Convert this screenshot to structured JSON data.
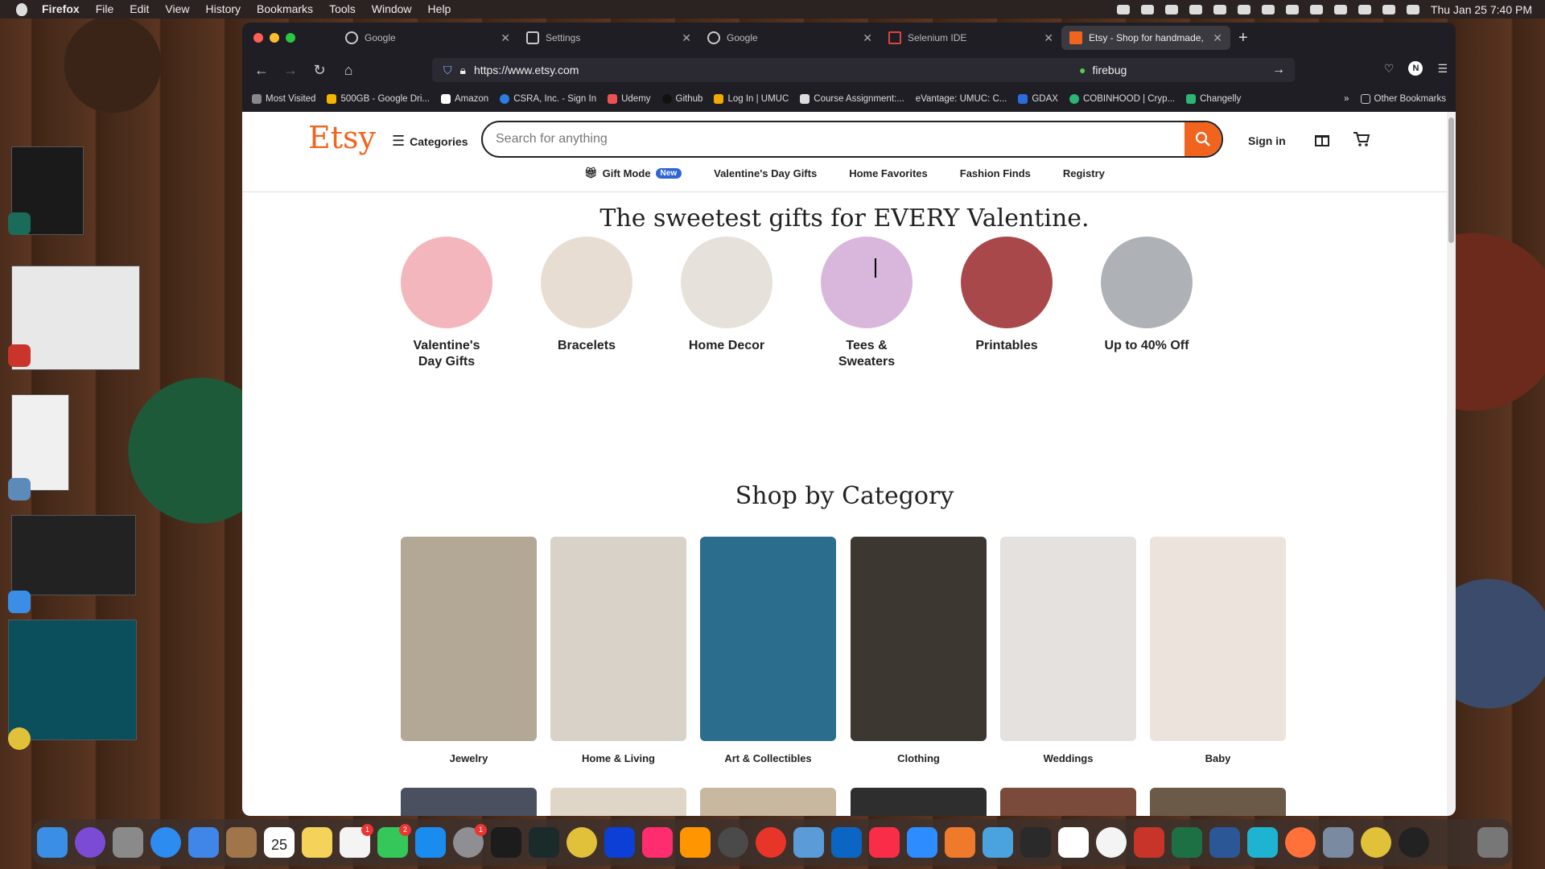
{
  "menubar": {
    "app": "Firefox",
    "items": [
      "File",
      "Edit",
      "View",
      "History",
      "Bookmarks",
      "Tools",
      "Window",
      "Help"
    ],
    "clock": "Thu Jan 25  7:40 PM",
    "recording": "Recording"
  },
  "browser": {
    "tabs": [
      {
        "title": "Google"
      },
      {
        "title": "Settings"
      },
      {
        "title": "Google"
      },
      {
        "title": "Selenium IDE"
      },
      {
        "title": "Etsy - Shop for handmade, vinta"
      }
    ],
    "url": "https://www.etsy.com",
    "search_text": "firebug",
    "bookmarks": [
      "Most Visited",
      "500GB - Google Dri...",
      "Amazon",
      "CSRA, Inc. - Sign In",
      "Udemy",
      "Github",
      "Log In | UMUC",
      "Course Assignment:...",
      "eVantage: UMUC: C...",
      "GDAX",
      "COBINHOOD | Cryp...",
      "Changelly"
    ],
    "other_bookmarks": "Other Bookmarks",
    "profile_initial": "N"
  },
  "etsy": {
    "logo": "Etsy",
    "categories_label": "Categories",
    "search_placeholder": "Search for anything",
    "sign_in": "Sign in",
    "subnav": [
      {
        "label": "Gift Mode",
        "badge": "New"
      },
      {
        "label": "Valentine's Day Gifts"
      },
      {
        "label": "Home Favorites"
      },
      {
        "label": "Fashion Finds"
      },
      {
        "label": "Registry"
      }
    ],
    "hero": "The sweetest gifts for EVERY Valentine.",
    "circles": [
      {
        "line1": "Valentine's",
        "line2": "Day Gifts",
        "color": "#f3b6bd"
      },
      {
        "line1": "Bracelets",
        "line2": "",
        "color": "#e8ddd2"
      },
      {
        "line1": "Home Decor",
        "line2": "",
        "color": "#e6e1da"
      },
      {
        "line1": "Tees &",
        "line2": "Sweaters",
        "color": "#d9b7dd"
      },
      {
        "line1": "Printables",
        "line2": "",
        "color": "#a9484a"
      },
      {
        "line1": "Up to 40% Off",
        "line2": "",
        "color": "#aeb1b6"
      }
    ],
    "shop_heading": "Shop by Category",
    "tiles": [
      {
        "label": "Jewelry",
        "color": "#b3a796"
      },
      {
        "label": "Home & Living",
        "color": "#d8d2c8"
      },
      {
        "label": "Art & Collectibles",
        "color": "#2b6d8c"
      },
      {
        "label": "Clothing",
        "color": "#3d3732"
      },
      {
        "label": "Weddings",
        "color": "#e4e1de"
      },
      {
        "label": "Baby",
        "color": "#ece4dc"
      }
    ]
  },
  "dock": {
    "badges": {
      "calendar_day": "25",
      "reminders": "1",
      "messages": "2",
      "settings": "1"
    }
  }
}
